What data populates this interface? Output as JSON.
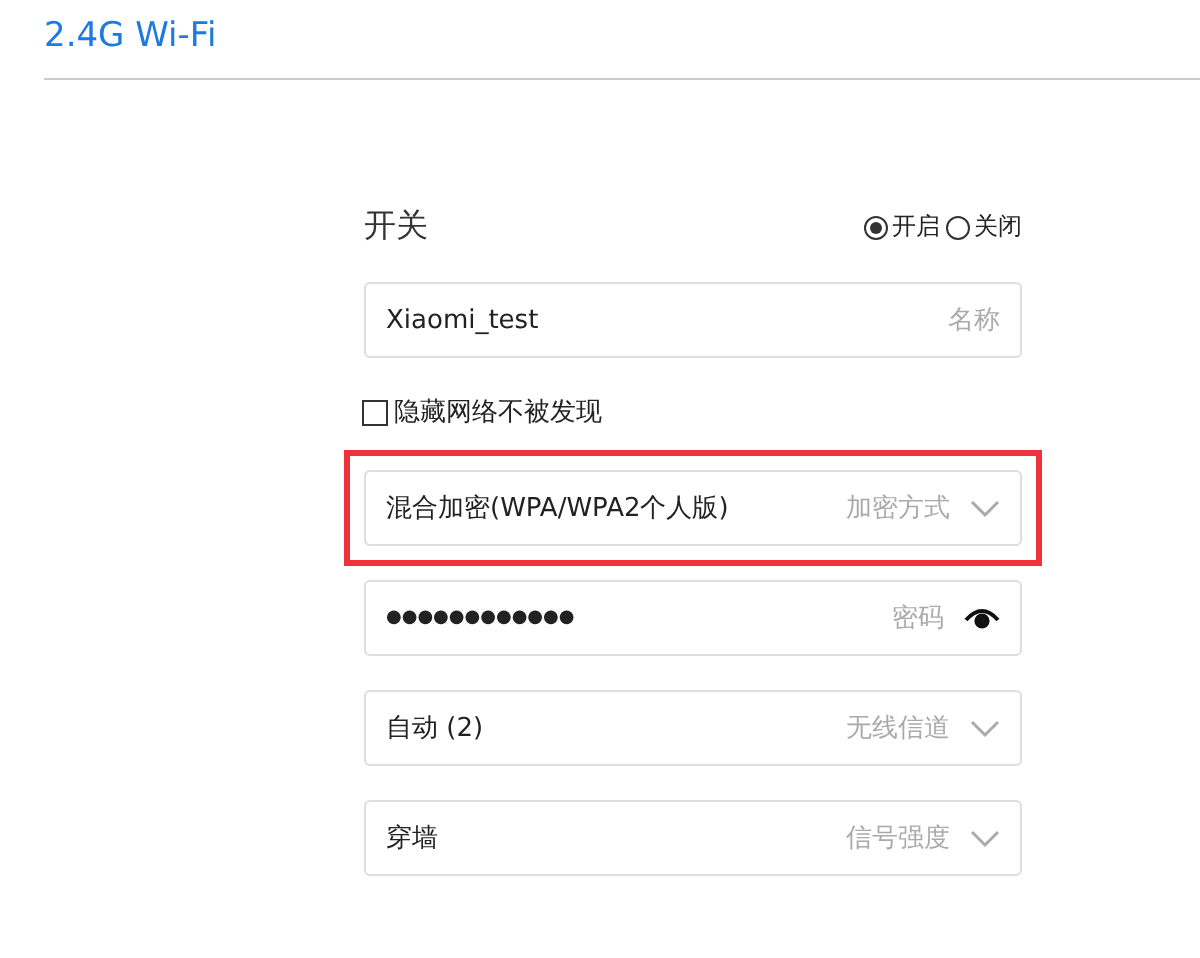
{
  "title": "2.4G Wi-Fi",
  "switch": {
    "label": "开关",
    "options": [
      {
        "label": "开启",
        "selected": true
      },
      {
        "label": "关闭",
        "selected": false
      }
    ]
  },
  "fields": [
    {
      "kind": "text",
      "value": "Xiaomi_test",
      "label": "名称",
      "highlighted": false
    },
    {
      "kind": "checkbox",
      "text": "隐藏网络不被发现",
      "checked": false
    },
    {
      "kind": "select",
      "value": "混合加密(WPA/WPA2个人版)",
      "label": "加密方式",
      "highlighted": true
    },
    {
      "kind": "password",
      "value": "●●●●●●●●●●●●",
      "label": "密码",
      "highlighted": false
    },
    {
      "kind": "select",
      "value": "自动 (2)",
      "label": "无线信道",
      "highlighted": false
    },
    {
      "kind": "select",
      "value": "穿墙",
      "label": "信号强度",
      "highlighted": false
    }
  ]
}
